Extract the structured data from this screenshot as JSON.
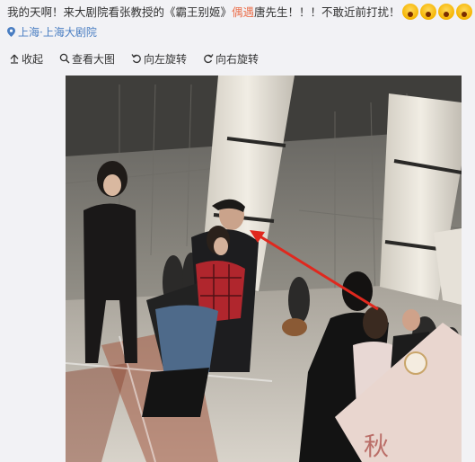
{
  "post": {
    "text_part1": "我的天啊！来大剧院看张教授的《霸王别姬》",
    "text_highlight": "偶遇",
    "text_part2": "唐先生！！！不敢近前打扰！",
    "emoji_names": [
      "scream-emoji",
      "scream-emoji",
      "scream-emoji",
      "scream-emoji"
    ]
  },
  "location": {
    "label": "上海·上海大剧院",
    "icon": "location-pin-icon"
  },
  "toolbar": {
    "collapse": {
      "label": "收起",
      "icon": "collapse-arrow-icon"
    },
    "view_large": {
      "label": "查看大图",
      "icon": "magnifier-icon"
    },
    "rotate_left": {
      "label": "向左旋转",
      "icon": "rotate-left-icon"
    },
    "rotate_right": {
      "label": "向右旋转",
      "icon": "rotate-right-icon"
    }
  },
  "photo": {
    "description_icon": "photo-image",
    "accent": "#e0281e"
  },
  "colors": {
    "link": "#4a7ec2",
    "highlight": "#eb7350",
    "background": "#f2f2f5"
  }
}
